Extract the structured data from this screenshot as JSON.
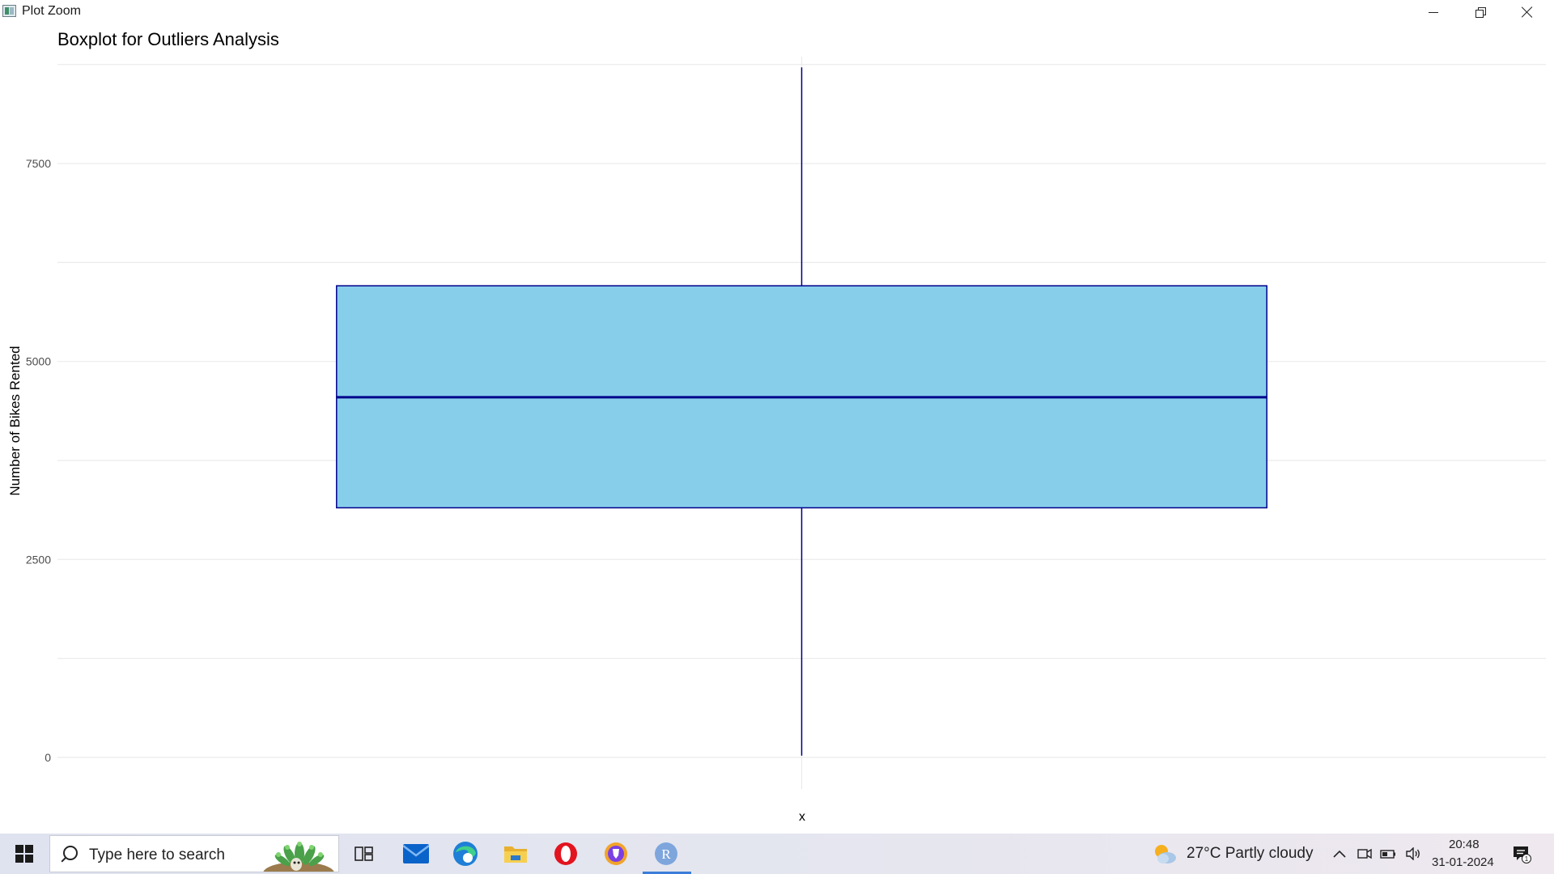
{
  "window": {
    "title": "Plot Zoom",
    "app_icon": "plot-window-icon",
    "controls": [
      "minimize-icon",
      "maximize-icon",
      "close-icon"
    ]
  },
  "chart_data": {
    "type": "boxplot",
    "title": "Boxplot for Outliers Analysis",
    "xlabel": "x",
    "ylabel": "Number of Bikes Rented",
    "ylim": [
      -400,
      8850
    ],
    "yticks": [
      0,
      2500,
      5000,
      7500
    ],
    "ytick_labels": [
      "0",
      "2500",
      "5000",
      "7500"
    ],
    "grid": true,
    "box": {
      "min": 22,
      "q1": 3152,
      "median": 4548,
      "q3": 5956,
      "max": 8714
    },
    "colors": {
      "box_fill": "#87CEEB",
      "box_outline": "#00008B",
      "median_line": "#00008B",
      "grid": "#ebebeb"
    }
  },
  "taskbar": {
    "start_icon": "windows-start-icon",
    "search_placeholder": "Type here to search",
    "pinned": [
      "task-view-icon",
      "mail-icon",
      "edge-icon",
      "file-explorer-icon",
      "opera-icon",
      "brave-icon",
      "r-icon"
    ],
    "weather": {
      "icon": "partly-cloudy-icon",
      "text": "27°C  Partly cloudy"
    },
    "tray_icons": [
      "chevron-up-icon",
      "meet-now-icon",
      "battery-icon",
      "volume-icon"
    ],
    "time": "20:48",
    "date": "31-01-2024",
    "notification_count": "1"
  }
}
